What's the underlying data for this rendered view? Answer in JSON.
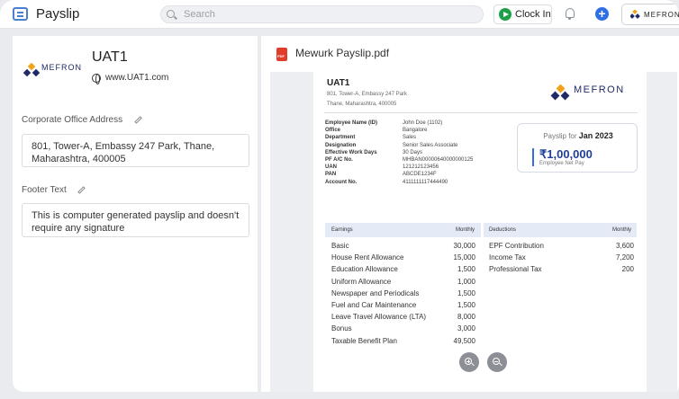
{
  "header": {
    "app_title": "Payslip",
    "search_placeholder": "Search",
    "clock_in_label": "Clock In",
    "org_chip_label": "MEFRON"
  },
  "left_panel": {
    "org_logo_text": "MEFRON",
    "org_name": "UAT1",
    "website": "www.UAT1.com",
    "address_label": "Corporate Office Address",
    "address_value": "801, Tower-A, Embassy 247 Park, Thane, Maharashtra, 400005",
    "footer_label": "Footer Text",
    "footer_value": "This is computer generated payslip and doesn't require any signature"
  },
  "preview": {
    "file_name": "Mewurk Payslip.pdf",
    "company": "UAT1",
    "address_line1": "801, Tower-A, Embassy 247 Park",
    "address_line2": "Thane, Maharashtra, 400005",
    "logo_text": "MEFRON",
    "employee_details": [
      {
        "label": "Employee Name (ID)",
        "value": "John Doe (1102)"
      },
      {
        "label": "Office",
        "value": "Bangalore"
      },
      {
        "label": "Department",
        "value": "Sales"
      },
      {
        "label": "Designation",
        "value": "Senior Sales Associate"
      },
      {
        "label": "Effective Work Days",
        "value": "30 Days"
      },
      {
        "label": "PF A/C No.",
        "value": "MHBAN00000640000000125"
      },
      {
        "label": "UAN",
        "value": "121212123456"
      },
      {
        "label": "PAN",
        "value": "ABCDE1234F"
      },
      {
        "label": "Account No.",
        "value": "4111111117444490"
      }
    ],
    "payslip_for_label": "Payslip for",
    "payslip_month": "Jan 2023",
    "net_pay_amount": "₹1,00,000",
    "net_pay_label": "Employee Net Pay",
    "earnings_header": "Earnings",
    "earnings_monthly_header": "Monthly",
    "deductions_header": "Deductions",
    "deductions_monthly_header": "Monthly",
    "earnings": [
      {
        "name": "Basic",
        "amount": "30,000"
      },
      {
        "name": "House Rent Allowance",
        "amount": "15,000"
      },
      {
        "name": "Education Allowance",
        "amount": "1,500"
      },
      {
        "name": "Uniform Allowance",
        "amount": "1,000"
      },
      {
        "name": "Newspaper and Periodicals",
        "amount": "1,500"
      },
      {
        "name": "Fuel and Car Maintenance",
        "amount": "1,500"
      },
      {
        "name": "Leave Travel Allowance (LTA)",
        "amount": "8,000"
      },
      {
        "name": "Bonus",
        "amount": "3,000"
      },
      {
        "name": "Taxable Benefit Plan",
        "amount": "49,500"
      }
    ],
    "deductions": [
      {
        "name": "EPF Contribution",
        "amount": "3,600"
      },
      {
        "name": "Income Tax",
        "amount": "7,200"
      },
      {
        "name": "Professional Tax",
        "amount": "200"
      }
    ]
  },
  "colors": {
    "accent": "#2f6fe4",
    "clock_in_green": "#1ea04a",
    "pdf_red": "#e23c2c",
    "table_header": "#e4ebf7"
  }
}
